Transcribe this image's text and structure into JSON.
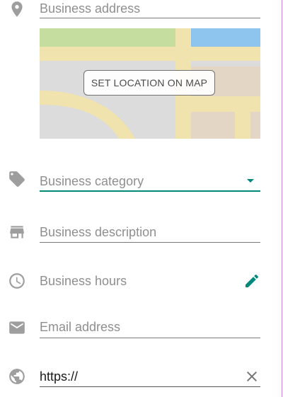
{
  "form": {
    "address": {
      "placeholder": "Business address",
      "icon": "location-pin-icon"
    },
    "map": {
      "button_label": "SET LOCATION ON MAP"
    },
    "category": {
      "placeholder": "Business category",
      "icon": "tag-icon"
    },
    "description": {
      "placeholder": "Business description",
      "icon": "storefront-icon"
    },
    "hours": {
      "label": "Business hours",
      "icon": "clock-icon"
    },
    "email": {
      "placeholder": "Email address",
      "icon": "mail-icon"
    },
    "website": {
      "value": "https://",
      "icon": "globe-icon"
    }
  },
  "colors": {
    "accent": "#00897b",
    "icon_grey": "#9e9e9e",
    "placeholder_grey": "#8f8f8f",
    "edge_line": "#9c27b0"
  }
}
